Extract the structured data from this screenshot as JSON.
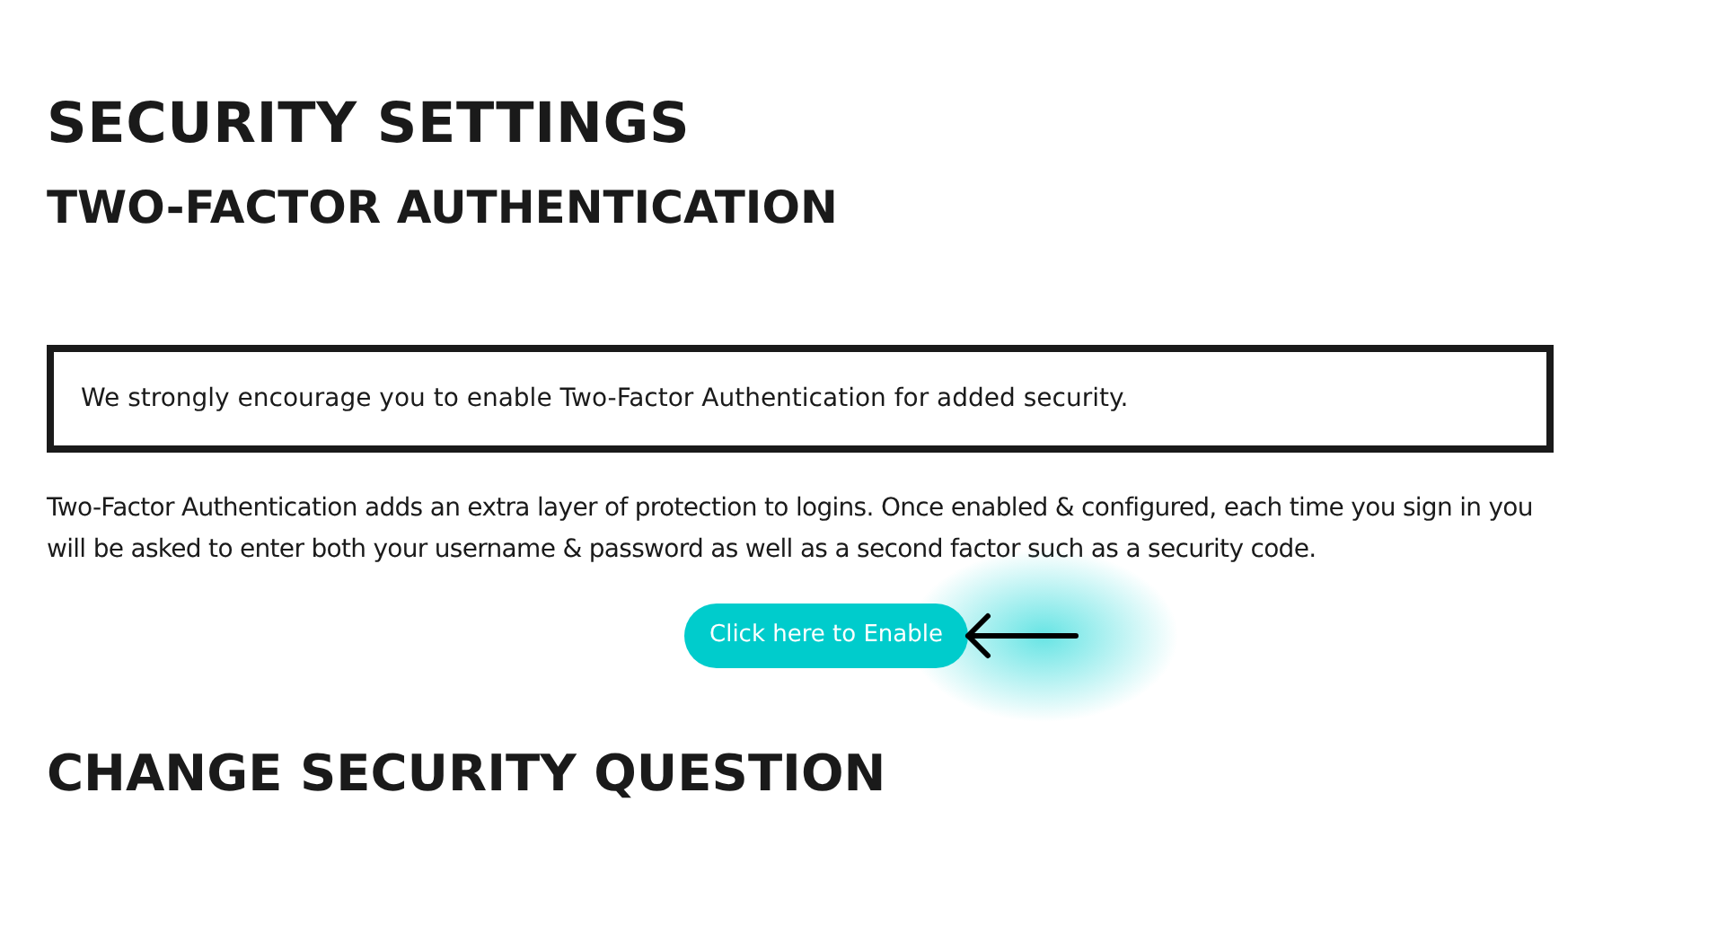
{
  "page_title": "SECURITY SETTINGS",
  "two_factor": {
    "heading": "TWO-FACTOR AUTHENTICATION",
    "notice": "We strongly encourage you to enable Two-Factor Authentication for added security.",
    "description": "Two-Factor Authentication adds an extra layer of protection to logins. Once enabled & configured, each time you sign in you will be asked to enter both your username & password as well as a second factor such as a security code.",
    "button": "Click here to Enable"
  },
  "security_question": {
    "heading": "CHANGE SECURITY QUESTION"
  }
}
